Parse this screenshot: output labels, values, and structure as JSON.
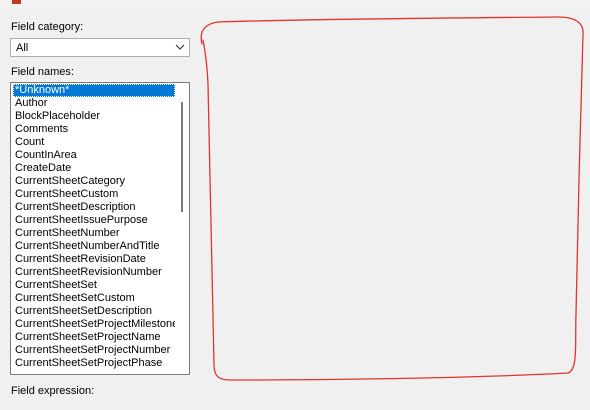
{
  "labels": {
    "field_category": "Field category:",
    "field_names": "Field names:",
    "field_expression": "Field expression:"
  },
  "category": {
    "selected": "All"
  },
  "field_names": [
    "*Unknown*",
    "Author",
    "BlockPlaceholder",
    "Comments",
    "Count",
    "CountInArea",
    "CreateDate",
    "CurrentSheetCategory",
    "CurrentSheetCustom",
    "CurrentSheetDescription",
    "CurrentSheetIssuePurpose",
    "CurrentSheetNumber",
    "CurrentSheetNumberAndTitle",
    "CurrentSheetRevisionDate",
    "CurrentSheetRevisionNumber",
    "CurrentSheetSet",
    "CurrentSheetSetCustom",
    "CurrentSheetSetDescription",
    "CurrentSheetSetProjectMilestone",
    "CurrentSheetSetProjectName",
    "CurrentSheetSetProjectNumber",
    "CurrentSheetSetProjectPhase"
  ],
  "selected_field": "*Unknown*",
  "colors": {
    "selection": "#0078d7",
    "annotation": "#e0342f",
    "window_bg": "#f0f0f0"
  },
  "icons": {
    "combo_arrow": "chevron-down-icon",
    "app": "app-icon"
  }
}
